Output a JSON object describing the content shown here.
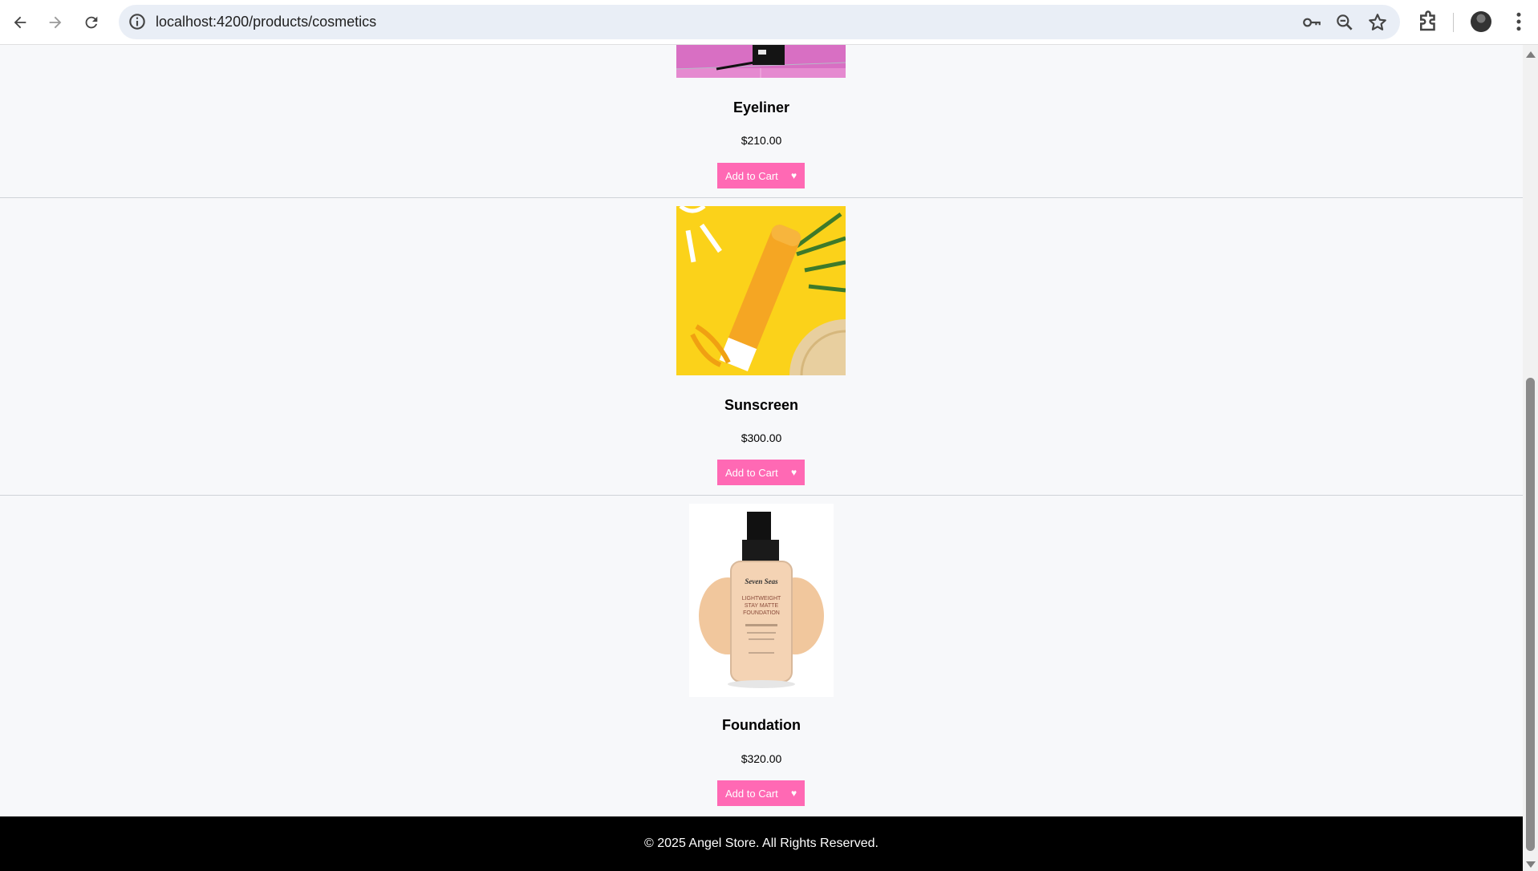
{
  "browser": {
    "url": "localhost:4200/products/cosmetics",
    "icons": [
      "back-arrow-icon",
      "forward-arrow-icon",
      "reload-icon",
      "site-info-icon",
      "password-key-icon",
      "zoom-icon",
      "bookmark-star-icon",
      "extensions-icon",
      "profile-avatar",
      "menu-dots-icon"
    ]
  },
  "products": [
    {
      "name": "Eyeliner",
      "price": "$210.00",
      "image": "eyeliner-photo"
    },
    {
      "name": "Sunscreen",
      "price": "$300.00",
      "image": "sunscreen-photo"
    },
    {
      "name": "Foundation",
      "price": "$320.00",
      "image": "foundation-photo",
      "image_label": [
        "Seven Seas",
        "LIGHTWEIGHT",
        "STAY MATTE",
        "FOUNDATION"
      ]
    }
  ],
  "buttons": {
    "add_to_cart": "Add to Cart",
    "wishlist_icon": "heart-icon"
  },
  "footer": {
    "text": "© 2025 Angel Store. All Rights Reserved."
  },
  "colors": {
    "accent": "#ff69b4",
    "page_bg": "#f7f8fa",
    "footer_bg": "#000000"
  }
}
